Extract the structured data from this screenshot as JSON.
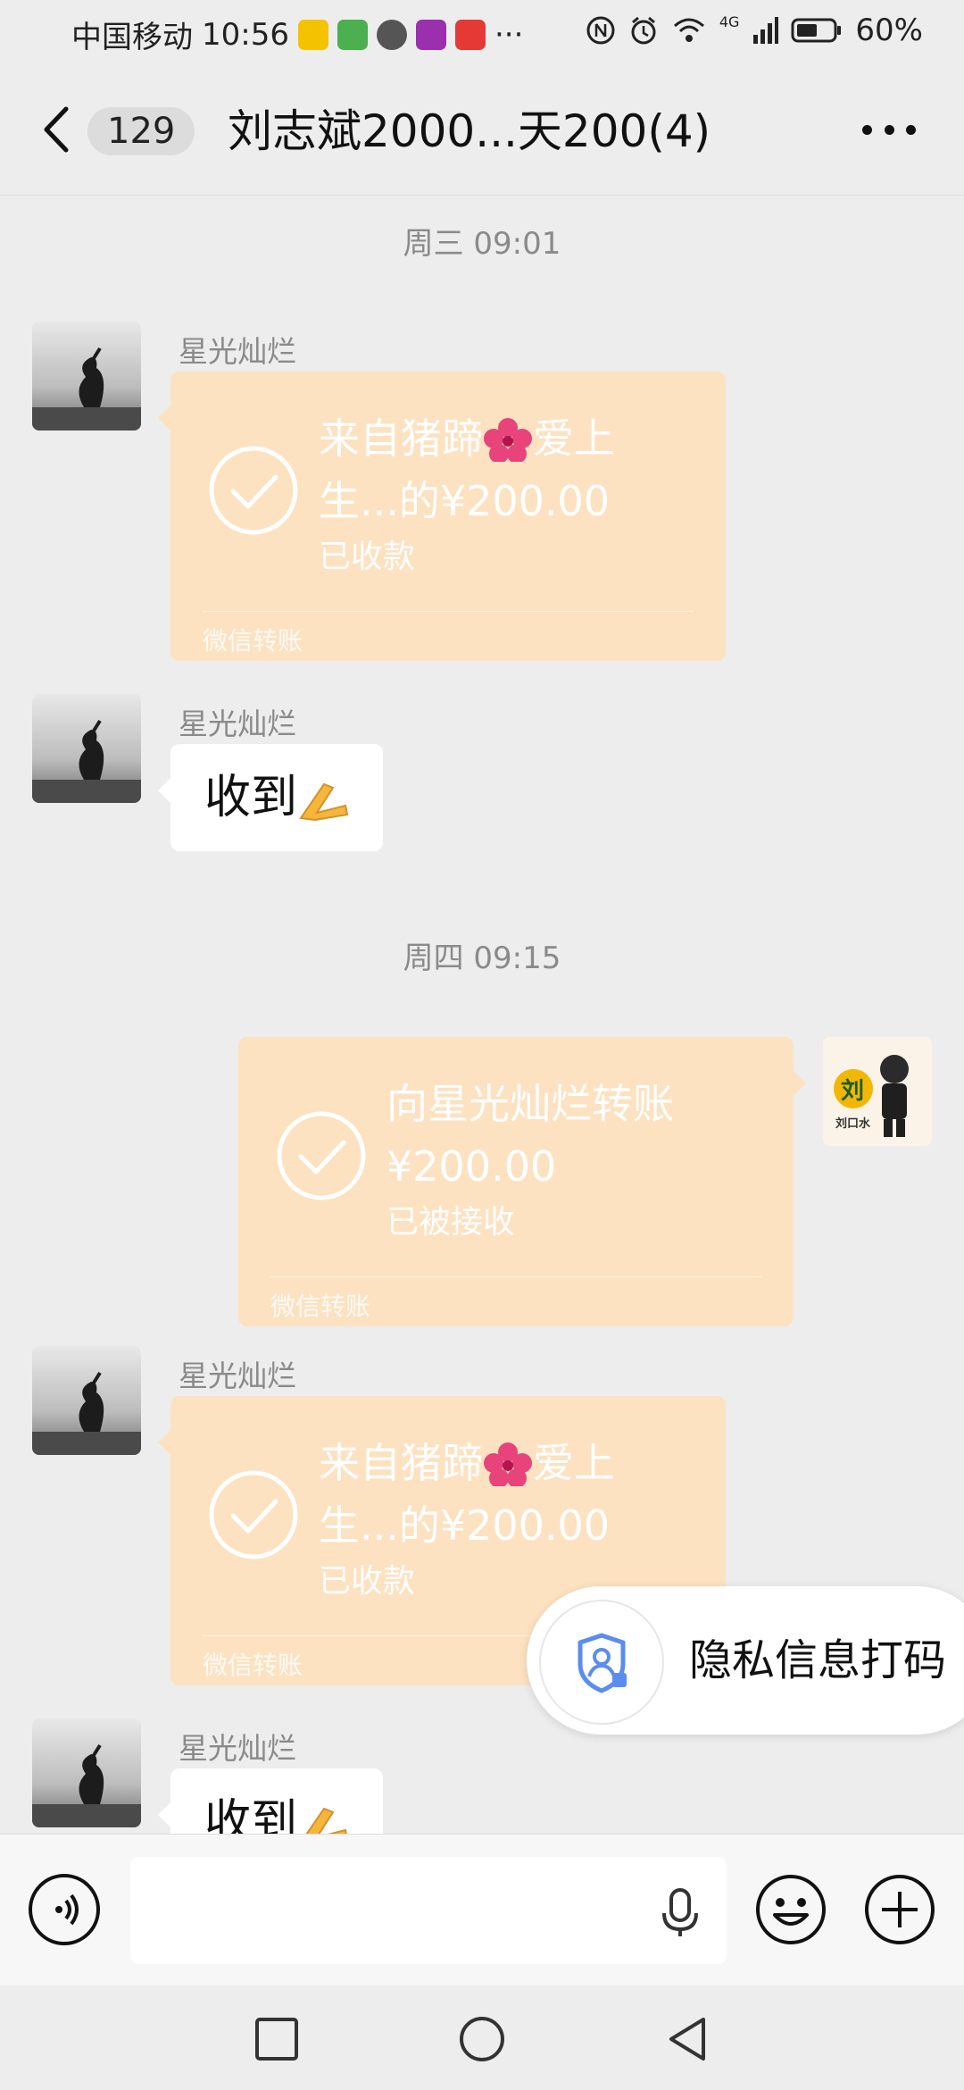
{
  "status_bar": {
    "carrier": "中国移动",
    "time": "10:56",
    "more": "···",
    "network": "4G",
    "battery": "60%",
    "app_icons": [
      "weibo-icon",
      "video-app-icon",
      "browser-icon",
      "bank-app-icon",
      "pay-app-icon"
    ],
    "status_icons": [
      "nfc-icon",
      "alarm-icon",
      "wifi-icon",
      "signal-icon",
      "battery-icon"
    ]
  },
  "nav": {
    "unread_count": "129",
    "title": "刘志斌2000...天200(4)"
  },
  "messages": [
    {
      "type": "time",
      "text": "周三 09:01"
    },
    {
      "type": "transfer",
      "side": "left",
      "sender": "星光灿烂",
      "line1": "来自猪蹄",
      "line1b": "爱上",
      "line2": "生...的¥200.00",
      "status": "已收款",
      "footer": "微信转账"
    },
    {
      "type": "text",
      "side": "left",
      "sender": "星光灿烂",
      "text": "收到"
    },
    {
      "type": "time",
      "text": "周四 09:15"
    },
    {
      "type": "transfer",
      "side": "right",
      "line1": "向星光灿烂转账",
      "line2": "¥200.00",
      "status": "已被接收",
      "footer": "微信转账"
    },
    {
      "type": "transfer",
      "side": "left",
      "sender": "星光灿烂",
      "line1": "来自猪蹄",
      "line1b": "爱上",
      "line2": "生...的¥200.00",
      "status": "已收款",
      "footer": "微信转账"
    },
    {
      "type": "text",
      "side": "left",
      "sender": "星光灿烂",
      "text": "收到"
    }
  ],
  "self_avatar": {
    "char": "刘",
    "caption": "刘口水"
  },
  "privacy_popup": {
    "label": "隐私信息打码"
  },
  "input_bar": {
    "text_value": ""
  },
  "colors": {
    "transfer_bg": "#fde2c1",
    "chat_bg": "#ededed",
    "privacy_icon": "#5b8def"
  }
}
